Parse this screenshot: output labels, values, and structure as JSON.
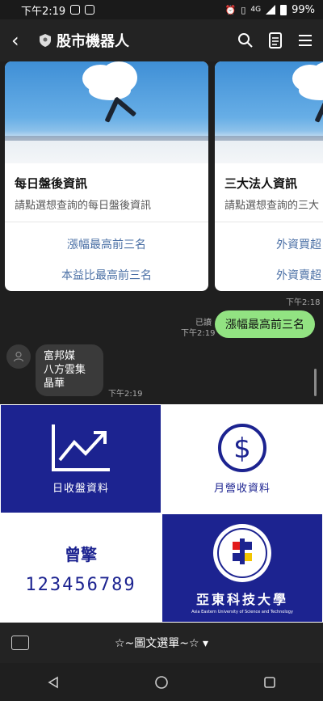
{
  "status": {
    "time": "下午2:19",
    "network": "4G",
    "battery": "99%"
  },
  "header": {
    "title": "股市機器人"
  },
  "cards": [
    {
      "title": "每日盤後資訊",
      "desc": "請點選想查詢的每日盤後資訊",
      "actions": [
        "漲幅最高前三名",
        "本益比最高前三名"
      ]
    },
    {
      "title": "三大法人資訊",
      "desc": "請點選想查詢的三大",
      "actions": [
        "外資買超",
        "外資賣超"
      ]
    }
  ],
  "carousel_time": "下午2:18",
  "my_message": {
    "read": "已讀",
    "time": "下午2:19",
    "text": "漲幅最高前三名"
  },
  "bot_message": {
    "lines": [
      "富邦媒",
      "八方雲集",
      "晶華"
    ],
    "time": "下午2:19"
  },
  "richmenu": {
    "cell1": "日收盤資料",
    "cell2": "月營收資料",
    "cell3_title": "曾擎",
    "cell3_num": "123456789",
    "cell4_name": "亞東科技大學",
    "cell4_en": "Asia Eastern University of Science and Technology"
  },
  "bottom_bar": {
    "label": "☆~圖文選單~☆ ▾"
  },
  "colors": {
    "accent_green": "#92e382",
    "menu_blue": "#1c2390",
    "link_blue": "#4a6fa5"
  },
  "icons": [
    "back-icon",
    "shield-icon",
    "search-icon",
    "note-icon",
    "menu-icon",
    "keyboard-icon",
    "chart-icon",
    "dollar-icon"
  ]
}
